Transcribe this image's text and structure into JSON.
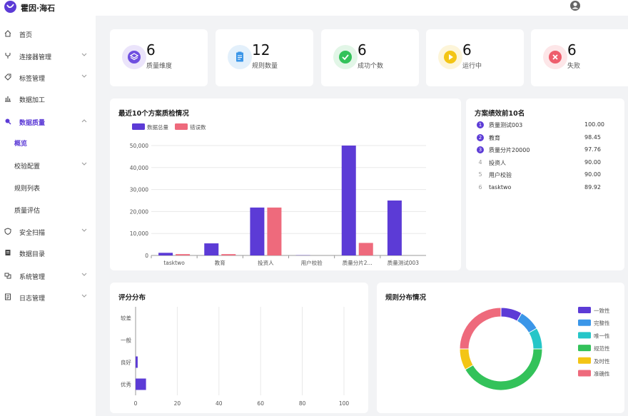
{
  "app": {
    "brand": "霍因·海石"
  },
  "sidebar": {
    "items": [
      {
        "label": "首页",
        "icon": "home-icon",
        "chevron": false
      },
      {
        "label": "连接器管理",
        "icon": "plug-icon",
        "chevron": true
      },
      {
        "label": "标签管理",
        "icon": "tag-icon",
        "chevron": true
      },
      {
        "label": "数据加工",
        "icon": "bar-chart-icon",
        "chevron": false
      },
      {
        "label": "数据质量",
        "icon": "quality-icon",
        "chevron": true,
        "active": true
      },
      {
        "label": "安全扫描",
        "icon": "shield-icon",
        "chevron": true
      },
      {
        "label": "数据目录",
        "icon": "catalog-icon",
        "chevron": false
      },
      {
        "label": "系统管理",
        "icon": "system-icon",
        "chevron": true
      },
      {
        "label": "日志管理",
        "icon": "log-icon",
        "chevron": true
      }
    ],
    "sub_items": [
      {
        "label": "概览",
        "active": true,
        "chevron": false
      },
      {
        "label": "校验配置",
        "active": false,
        "chevron": true
      },
      {
        "label": "规则列表",
        "active": false,
        "chevron": false
      },
      {
        "label": "质量评估",
        "active": false,
        "chevron": false
      }
    ]
  },
  "stats": [
    {
      "value": "6",
      "label": "质量维度",
      "icon": "layers-icon",
      "color": "#6f4fe0",
      "bg": "#ebe4fb"
    },
    {
      "value": "12",
      "label": "规则数量",
      "icon": "clipboard-icon",
      "color": "#3b96e8",
      "bg": "#e3f0fb"
    },
    {
      "value": "6",
      "label": "成功个数",
      "icon": "check-icon",
      "color": "#33c25a",
      "bg": "#e2f6e7"
    },
    {
      "value": "6",
      "label": "运行中",
      "icon": "play-icon",
      "color": "#f3c515",
      "bg": "#fdf5d9"
    },
    {
      "value": "6",
      "label": "失败",
      "icon": "close-icon",
      "color": "#ee5d6c",
      "bg": "#fde6e8"
    }
  ],
  "quality_chart": {
    "title": "最近10个方案质检情况",
    "legend": [
      "数据总量",
      "错误数"
    ]
  },
  "ranking": {
    "title": "方案绩效前10名",
    "rows": [
      {
        "rank": "1",
        "name": "质量测试003",
        "score": "100.00"
      },
      {
        "rank": "2",
        "name": "教育",
        "score": "98.45"
      },
      {
        "rank": "3",
        "name": "质量分片20000",
        "score": "97.76"
      },
      {
        "rank": "4",
        "name": "投资人",
        "score": "90.00"
      },
      {
        "rank": "5",
        "name": "用户校验",
        "score": "90.00"
      },
      {
        "rank": "6",
        "name": "tasktwo",
        "score": "89.92"
      }
    ]
  },
  "score_chart": {
    "title": "评分分布"
  },
  "rules_chart": {
    "title": "规则分布情况"
  },
  "chart_data": [
    {
      "type": "bar",
      "title": "最近10个方案质检情况",
      "categories": [
        "tasktwo",
        "教育",
        "投资人",
        "用户校验",
        "质量分片2...",
        "质量测试003"
      ],
      "series": [
        {
          "name": "数据总量",
          "values": [
            1200,
            5500,
            21800,
            100,
            50000,
            25000
          ],
          "color": "#5c3bd6"
        },
        {
          "name": "错误数",
          "values": [
            600,
            600,
            21800,
            0,
            5700,
            0
          ],
          "color": "#ee6a7c"
        }
      ],
      "yticks": [
        "0",
        "10,000",
        "20,000",
        "30,000",
        "40,000",
        "50,000"
      ],
      "ylim": [
        0,
        50000
      ],
      "legend": "top-left",
      "grid": true
    },
    {
      "type": "bar",
      "orientation": "horizontal",
      "title": "评分分布",
      "categories": [
        "较差",
        "一般",
        "良好",
        "优秀"
      ],
      "values": [
        0,
        0,
        1,
        5
      ],
      "xticks": [
        "0",
        "20",
        "40",
        "60",
        "80",
        "100"
      ],
      "xlim": [
        0,
        100
      ],
      "color": "#5c3bd6",
      "grid": true
    },
    {
      "type": "pie",
      "style": "donut",
      "title": "规则分布情况",
      "labels": [
        "一致性",
        "完整性",
        "唯一性",
        "规范性",
        "及时性",
        "准确性"
      ],
      "values": [
        1,
        1,
        1,
        5,
        1,
        3
      ],
      "colors": [
        "#5c3bd6",
        "#3b96e8",
        "#26c6c8",
        "#33c25a",
        "#f3c515",
        "#ee6a7c"
      ],
      "legend": "right"
    }
  ]
}
